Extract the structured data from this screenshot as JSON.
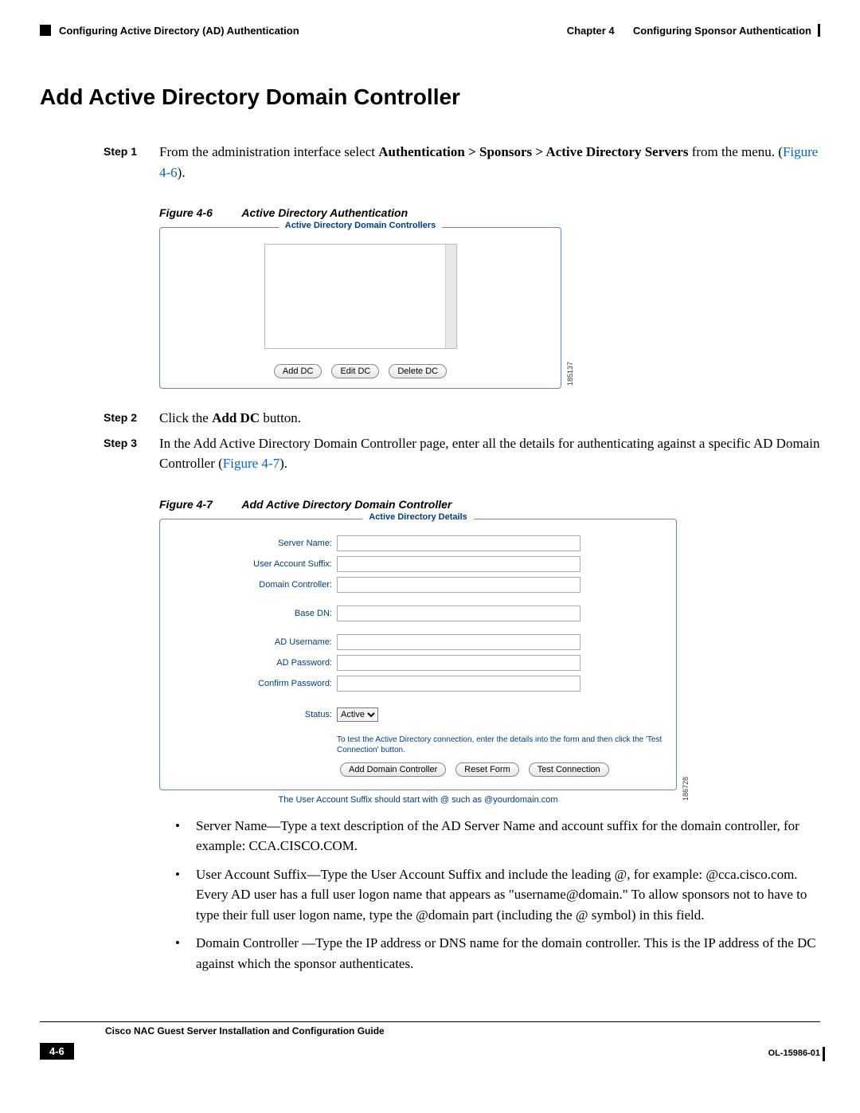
{
  "header": {
    "left": "Configuring Active Directory (AD) Authentication",
    "right_chapter": "Chapter 4",
    "right_title": "Configuring Sponsor Authentication"
  },
  "title": "Add Active Directory Domain Controller",
  "step1": {
    "label": "Step 1",
    "text_pre": "From the administration interface select ",
    "bold": "Authentication > Sponsors > Active Directory Servers",
    "text_post": " from the menu. (",
    "link": "Figure 4-6",
    "text_end": ")."
  },
  "fig46": {
    "num": "Figure 4-6",
    "title": "Active Directory Authentication",
    "legend": "Active Directory Domain Controllers",
    "btn_add": "Add DC",
    "btn_edit": "Edit DC",
    "btn_delete": "Delete DC",
    "side": "185137"
  },
  "step2": {
    "label": "Step 2",
    "text_pre": "Click the ",
    "bold": "Add DC",
    "text_post": " button."
  },
  "step3": {
    "label": "Step 3",
    "text_pre": "In the Add Active Directory Domain Controller page, enter all the details for authenticating against a specific AD Domain Controller (",
    "link": "Figure 4-7",
    "text_post": ")."
  },
  "fig47": {
    "num": "Figure 4-7",
    "title": "Add Active Directory Domain Controller",
    "legend": "Active Directory Details",
    "labels": {
      "server": "Server Name:",
      "suffix": "User Account Suffix:",
      "dc": "Domain Controller:",
      "basedn": "Base DN:",
      "aduser": "AD Username:",
      "adpass": "AD Password:",
      "confirm": "Confirm Password:",
      "status": "Status:"
    },
    "status_value": "Active",
    "helper": "To test the Active Directory connection, enter the details into the form and then click the 'Test Connection' button.",
    "btn_add": "Add Domain Controller",
    "btn_reset": "Reset Form",
    "btn_test": "Test Connection",
    "side": "186728",
    "footnote": "The User Account Suffix should start with @ such as @yourdomain.com"
  },
  "bullets": {
    "b1": "Server Name—Type a text description of the AD Server Name and account suffix for the domain controller, for example: CCA.CISCO.COM.",
    "b2": "User Account Suffix—Type the User Account Suffix and include the leading @, for example: @cca.cisco.com. Every AD user has a full user logon name that appears as \"username@domain.\" To allow sponsors not to have to type their full user logon name, type the @domain part (including the @ symbol) in this field.",
    "b3": "Domain Controller —Type the IP address or DNS name for the domain controller. This is the IP address of the DC against which the sponsor authenticates."
  },
  "footer": {
    "guide": "Cisco NAC Guest Server Installation and Configuration Guide",
    "page": "4-6",
    "doc": "OL-15986-01"
  }
}
